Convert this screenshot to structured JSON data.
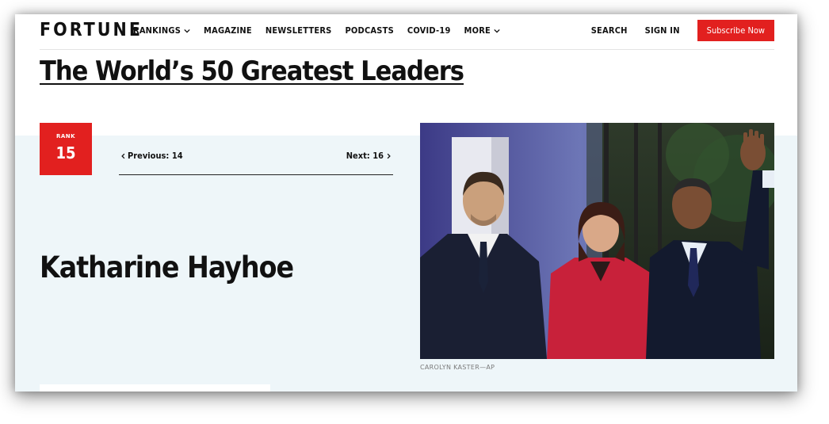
{
  "header": {
    "logo": "FORTUNE",
    "nav": [
      "RANKINGS",
      "MAGAZINE",
      "NEWSLETTERS",
      "PODCASTS",
      "COVID-19",
      "MORE"
    ],
    "search_label": "SEARCH",
    "signin_label": "SIGN IN",
    "subscribe_label": "Subscribe Now",
    "accent_color": "#e2201f"
  },
  "page": {
    "title": "The World’s 50 Greatest Leaders"
  },
  "ranking": {
    "rank_label": "RANK",
    "rank": "15",
    "previous_label": "Previous: 14",
    "next_label": "Next: 16"
  },
  "profile": {
    "name": "Katharine Hayhoe",
    "photo_credit": "CAROLYN KASTER—AP"
  }
}
